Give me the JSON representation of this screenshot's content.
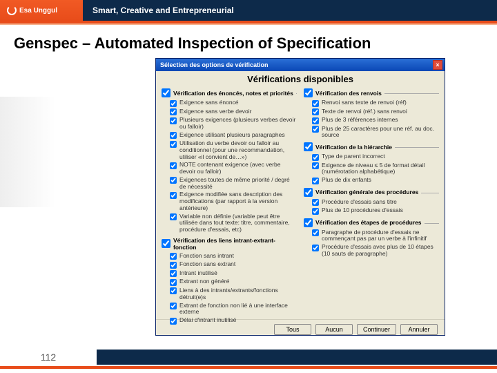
{
  "header": {
    "logo_text": "Esa Unggul",
    "tagline": "Smart, Creative and Entrepreneurial"
  },
  "slide": {
    "title": "Genspec – Automated Inspection of Specification",
    "page_number": "112"
  },
  "dialog": {
    "title": "Sélection des options de vérification",
    "heading": "Vérifications disponibles",
    "close": "×",
    "left": {
      "group1": {
        "header": "Vérification des énoncés, notes et priorités",
        "items": [
          "Exigence sans énoncé",
          "Exigence sans verbe devoir",
          "Plusieurs exigences (plusieurs verbes devoir ou falloir)",
          "Exigence utilisant plusieurs paragraphes",
          "Utilisation du verbe devoir ou falloir au conditionnel (pour une recommandation, utiliser «il convient de…»)",
          "NOTE contenant exigence (avec verbe devoir ou falloir)",
          "Exigences toutes de même priorité / degré de nécessité",
          "Exigence modifiée sans description des modifications (par rapport à la version antérieure)",
          "Variable non définie (variable peut être utilisée dans tout texte: titre, commentaire, procédure d'essais, etc)"
        ]
      },
      "group2": {
        "header": "Vérification des liens intrant-extrant-fonction",
        "items": [
          "Fonction sans intrant",
          "Fonction sans extrant",
          "Intrant inutilisé",
          "Extrant non généré",
          "Liens à des intrants/extrants/fonctions détruit(e)s",
          "Extrant de fonction non lié à une interface externe",
          "Délai d'intrant inutilisé"
        ]
      }
    },
    "right": {
      "group1": {
        "header": "Vérification des renvois",
        "items": [
          "Renvoi sans texte de renvoi (réf)",
          "Texte de renvoi (réf.) sans renvoi",
          "Plus de 3 références internes",
          "Plus de 25 caractères pour une réf. au doc. source"
        ]
      },
      "group2": {
        "header": "Vérification de la hiérarchie",
        "items": [
          "Type de parent incorrect",
          "Exigence de niveau ≤ 5 de format détail (numérotation alphabétique)",
          "Plus de dix enfants"
        ]
      },
      "group3": {
        "header": "Vérification générale des procédures",
        "items": [
          "Procédure d'essais sans titre",
          "Plus de 10 procédures d'essais"
        ]
      },
      "group4": {
        "header": "Vérification des étapes de procédures",
        "items": [
          "Paragraphe de procédure d'essais ne commençant pas par un verbe à l'infinitif",
          "Procédure d'essais avec plus de 10 étapes (10 sauts de paragraphe)"
        ]
      }
    },
    "buttons": {
      "tous": "Tous",
      "aucun": "Aucun",
      "continuer": "Continuer",
      "annuler": "Annuler"
    }
  }
}
